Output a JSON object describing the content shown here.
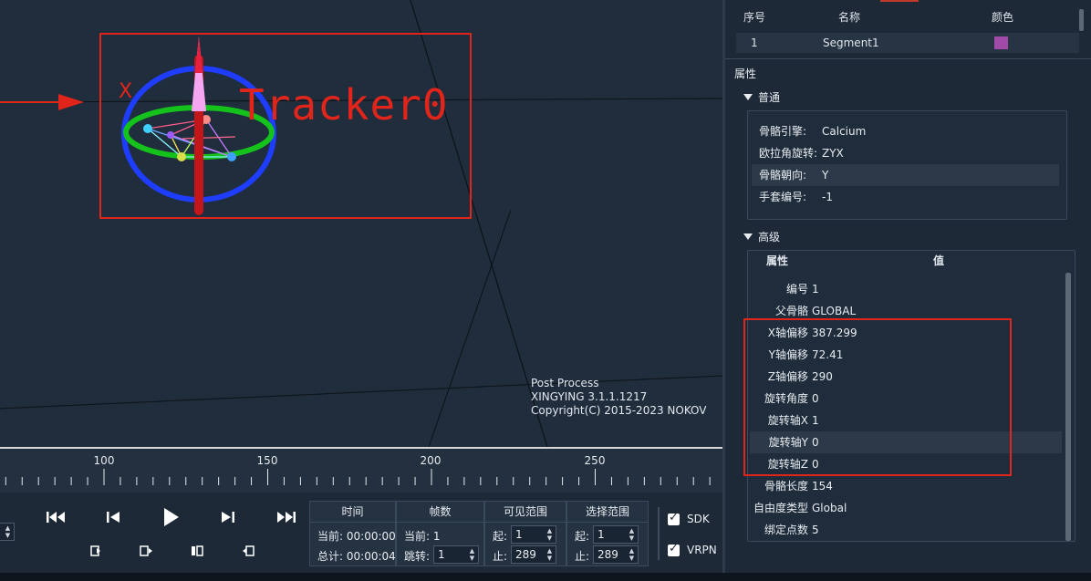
{
  "viewport": {
    "tracker_name": "Tracker0",
    "axis_label": "X",
    "watermark": {
      "line1": "Post Process",
      "line2": "XINGYING 3.1.1.1217",
      "line3": "Copyright(C) 2015-2023 NOKOV"
    }
  },
  "timeline": {
    "tick_labels": [
      "100",
      "150",
      "200",
      "250"
    ]
  },
  "controls": {
    "transport_icons": [
      "skip-to-start-icon",
      "step-back-icon",
      "play-icon",
      "step-forward-icon",
      "skip-to-end-icon"
    ],
    "time": {
      "header": "时间",
      "current_label": "当前:",
      "current_value": "00:00:00",
      "total_label": "总计:",
      "total_value": "00:00:04"
    },
    "frames": {
      "header": "帧数",
      "current_label": "当前:",
      "current_value": "1",
      "jump_label": "跳转:",
      "jump_value": "1"
    },
    "visible_range": {
      "header": "可见范围",
      "start_label": "起:",
      "start_value": "1",
      "end_label": "止:",
      "end_value": "289"
    },
    "selection_range": {
      "header": "选择范围",
      "start_label": "起:",
      "start_value": "1",
      "end_label": "止:",
      "end_value": "289"
    },
    "sdk_label": "SDK",
    "vrpn_label": "VRPN"
  },
  "segments": {
    "headers": [
      "序号",
      "名称",
      "颜色"
    ],
    "rows": [
      {
        "index": "1",
        "name": "Segment1",
        "color": "#a14aa8"
      }
    ]
  },
  "properties": {
    "title": "属性",
    "general": {
      "title": "普通",
      "rows": [
        {
          "key": "骨骼引擎:",
          "value": "Calcium"
        },
        {
          "key": "欧拉角旋转:",
          "value": "ZYX"
        },
        {
          "key": "骨骼朝向:",
          "value": "Y"
        },
        {
          "key": "手套编号:",
          "value": "-1"
        }
      ]
    },
    "advanced": {
      "title": "高级",
      "col_property": "属性",
      "col_value": "值",
      "rows": [
        {
          "key": "编号",
          "value": "1"
        },
        {
          "key": "父骨骼",
          "value": "GLOBAL"
        },
        {
          "key": "X轴偏移",
          "value": "387.299"
        },
        {
          "key": "Y轴偏移",
          "value": "72.41"
        },
        {
          "key": "Z轴偏移",
          "value": "290"
        },
        {
          "key": "旋转角度",
          "value": "0"
        },
        {
          "key": "旋转轴X",
          "value": "1"
        },
        {
          "key": "旋转轴Y",
          "value": "0"
        },
        {
          "key": "旋转轴Z",
          "value": "0"
        },
        {
          "key": "骨骼长度",
          "value": "154"
        },
        {
          "key": "自由度类型",
          "value": "Global"
        },
        {
          "key": "绑定点数",
          "value": "5"
        }
      ]
    }
  }
}
